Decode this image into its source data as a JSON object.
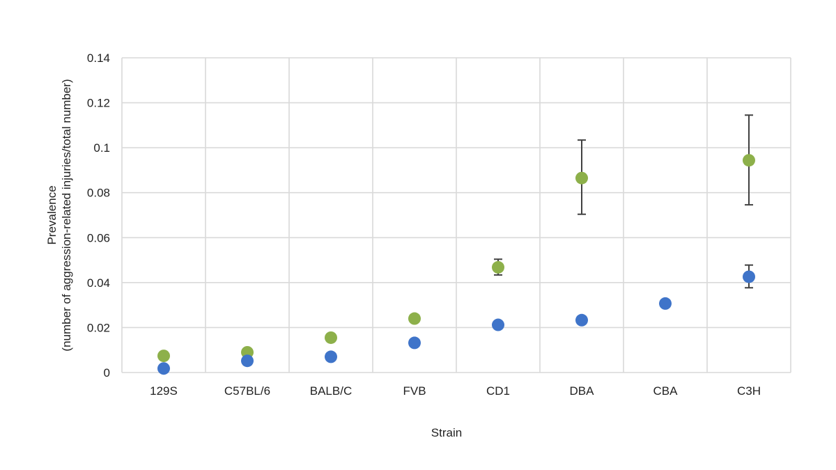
{
  "chart_data": {
    "type": "scatter",
    "title": "",
    "xlabel": "Strain",
    "ylabel": [
      "Prevalence",
      "(number of aggression-related injuries/total number)"
    ],
    "categories": [
      "129S",
      "C57BL/6",
      "BALB/C",
      "FVB",
      "CD1",
      "DBA",
      "CBA",
      "C3H"
    ],
    "ylim": [
      0,
      0.14
    ],
    "yticks": [
      0,
      0.02,
      0.04,
      0.06,
      0.08,
      0.1,
      0.12,
      0.14
    ],
    "ytick_labels": [
      "0",
      "0.02",
      "0.04",
      "0.06",
      "0.08",
      "0.1",
      "0.12",
      "0.14"
    ],
    "grid": true,
    "legend": "none",
    "series": [
      {
        "color": "#8DB04A",
        "values": [
          0.0074,
          0.009,
          0.0155,
          0.024,
          0.0468,
          0.0865,
          null,
          0.0944
        ],
        "error_low": [
          null,
          null,
          null,
          null,
          0.0434,
          0.0704,
          null,
          0.0746
        ],
        "error_high": [
          null,
          null,
          null,
          null,
          0.0504,
          0.1034,
          null,
          0.1145
        ]
      },
      {
        "color": "#3F74C9",
        "values": [
          0.0018,
          0.0052,
          0.007,
          0.0132,
          0.0212,
          0.0233,
          0.0307,
          0.0426
        ],
        "error_low": [
          null,
          null,
          null,
          null,
          null,
          null,
          null,
          0.0377
        ],
        "error_high": [
          null,
          null,
          null,
          null,
          null,
          null,
          null,
          0.0478
        ]
      }
    ]
  }
}
